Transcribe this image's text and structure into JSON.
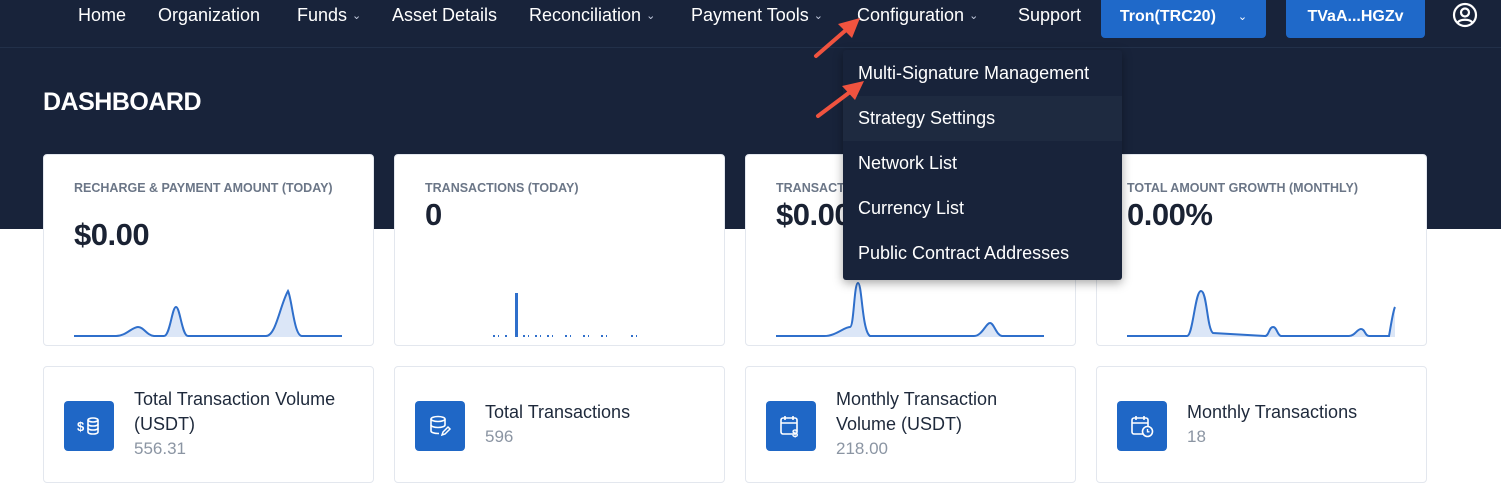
{
  "nav": {
    "items": [
      {
        "label": "Home",
        "has_dropdown": false
      },
      {
        "label": "Organization",
        "has_dropdown": false
      },
      {
        "label": "Funds",
        "has_dropdown": true
      },
      {
        "label": "Asset Details",
        "has_dropdown": false
      },
      {
        "label": "Reconciliation",
        "has_dropdown": true
      },
      {
        "label": "Payment Tools",
        "has_dropdown": true
      },
      {
        "label": "Configuration",
        "has_dropdown": true
      },
      {
        "label": "Support",
        "has_dropdown": false
      }
    ],
    "network_button": "Tron(TRC20)",
    "wallet_button": "TVaA...HGZv",
    "account_icon": "user-circle-icon"
  },
  "page": {
    "title": "DASHBOARD"
  },
  "stats": [
    {
      "label": "RECHARGE & PAYMENT AMOUNT (TODAY)",
      "value": "$0.00"
    },
    {
      "label": "TRANSACTIONS (TODAY)",
      "value": "0"
    },
    {
      "label": "TRANSACTION",
      "value": "$0.00"
    },
    {
      "label": "TOTAL AMOUNT GROWTH (MONTHLY)",
      "value": "0.00%"
    }
  ],
  "info_cards": [
    {
      "title_line1": "Total Transaction Volume",
      "title_line2": "(USDT)",
      "value": "556.31",
      "icon": "coins-dollar-icon"
    },
    {
      "title_line1": "Total Transactions",
      "title_line2": "",
      "value": "596",
      "icon": "database-edit-icon"
    },
    {
      "title_line1": "Monthly Transaction",
      "title_line2": "Volume (USDT)",
      "value": "218.00",
      "icon": "calendar-dollar-icon"
    },
    {
      "title_line1": "Monthly Transactions",
      "title_line2": "",
      "value": "18",
      "icon": "calendar-clock-icon"
    }
  ],
  "configuration_menu": {
    "items": [
      "Multi-Signature Management",
      "Strategy Settings",
      "Network List",
      "Currency List",
      "Public Contract Addresses"
    ],
    "hovered_index": 1
  },
  "colors": {
    "navy": "#18233a",
    "brand_blue": "#1f69c9",
    "spark_line": "#2f6fcb",
    "spark_fill": "#dbe6f7",
    "annotation_arrow": "#f0533f"
  }
}
